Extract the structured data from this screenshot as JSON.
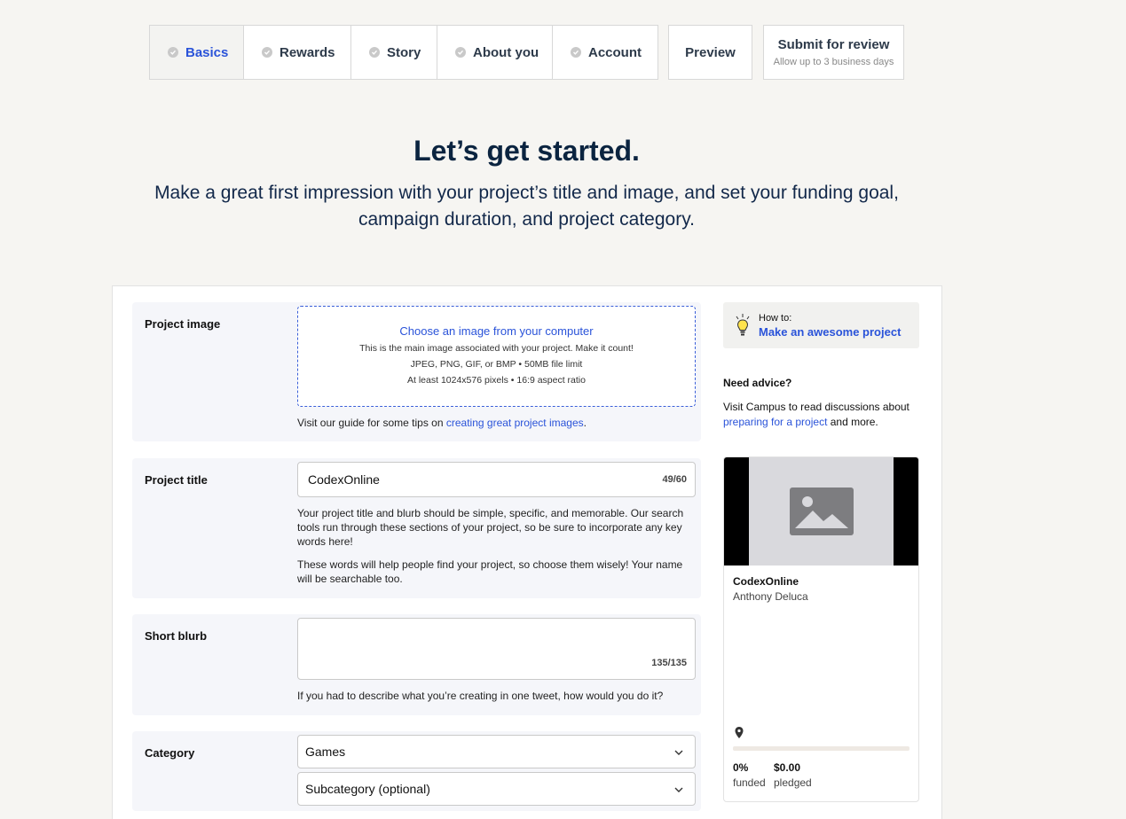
{
  "nav": {
    "tabs": [
      {
        "label": "Basics",
        "active": true
      },
      {
        "label": "Rewards",
        "active": false
      },
      {
        "label": "Story",
        "active": false
      },
      {
        "label": "About you",
        "active": false
      },
      {
        "label": "Account",
        "active": false
      }
    ],
    "preview_label": "Preview",
    "submit": {
      "label": "Submit for review",
      "sublabel": "Allow up to 3 business days"
    }
  },
  "hero": {
    "title": "Let’s get started.",
    "subtitle": "Make a great first impression with your project’s title and image, and set your funding goal, campaign duration, and project category."
  },
  "form": {
    "image": {
      "label": "Project image",
      "choose_text": "Choose an image from your computer",
      "info_1": "This is the main image associated with your project. Make it count!",
      "info_2": "JPEG, PNG, GIF, or BMP • 50MB file limit",
      "info_3": "At least 1024x576 pixels • 16:9 aspect ratio",
      "help_prefix": "Visit our guide for some tips on ",
      "help_link": "creating great project images",
      "help_suffix": "."
    },
    "title": {
      "label": "Project title",
      "value": "CodexOnline",
      "counter": "49/60",
      "help_1": "Your project title and blurb should be simple, specific, and memorable. Our search tools run through these sections of your project, so be sure to incorporate any key words here!",
      "help_2": "These words will help people find your project, so choose them wisely! Your name will be searchable too."
    },
    "blurb": {
      "label": "Short blurb",
      "value": "",
      "counter": "135/135",
      "help": "If you had to describe what you’re creating in one tweet, how would you do it?"
    },
    "category": {
      "label": "Category",
      "selected": "Games",
      "subcategory": "Subcategory (optional)"
    }
  },
  "sidebar": {
    "howto_prefix": "How to:",
    "howto_link": "Make an awesome project",
    "advice_title": "Need advice?",
    "advice_prefix": "Visit Campus to read discussions about ",
    "advice_link": "preparing for a project",
    "advice_suffix": " and more."
  },
  "preview_card": {
    "title": "CodexOnline",
    "author": "Anthony Deluca",
    "funded_fraction": 0,
    "funded_pct": "0%",
    "funded_label": "funded",
    "pledged_amount": "$0.00",
    "pledged_label": "pledged"
  },
  "colors": {
    "accent": "#2a53d9",
    "heading": "#0b2440",
    "background": "#f6f5f2"
  }
}
